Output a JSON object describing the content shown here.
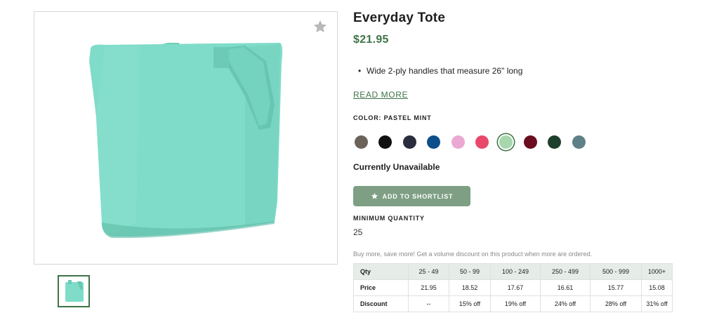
{
  "product": {
    "title": "Everyday Tote",
    "price": "$21.95",
    "bullets": [
      "Wide 2-ply handles that measure 26\" long"
    ],
    "read_more": "READ MORE",
    "color_label": "COLOR: PASTEL MINT",
    "availability": "Currently Unavailable",
    "add_to_shortlist": "ADD TO SHORTLIST",
    "min_qty_label": "MINIMUM QUANTITY",
    "min_qty_value": "25",
    "volume_note": "Buy more, save more! Get a volume discount on this product when more are ordered."
  },
  "swatches": [
    {
      "color": "#6b635a"
    },
    {
      "color": "#111111"
    },
    {
      "color": "#2a2d3d"
    },
    {
      "color": "#0d4f8a"
    },
    {
      "color": "#eba8d2"
    },
    {
      "color": "#e9486b"
    },
    {
      "color": "#a6d7ad",
      "selected": true
    },
    {
      "color": "#6a0d1f"
    },
    {
      "color": "#1d3f2b"
    },
    {
      "color": "#5e8087"
    }
  ],
  "pricing_table": {
    "headers": [
      "Qty",
      "25 - 49",
      "50 - 99",
      "100 - 249",
      "250 - 499",
      "500 - 999",
      "1000+"
    ],
    "rows": [
      [
        "Price",
        "21.95",
        "18.52",
        "17.67",
        "16.61",
        "15.77",
        "15.08"
      ],
      [
        "Discount",
        "--",
        "15% off",
        "19% off",
        "24% off",
        "28% off",
        "31% off"
      ]
    ]
  },
  "colors": {
    "brand_green": "#3d7347",
    "button_green": "#7e9f84",
    "tote_mint": "#7fdcc8",
    "header_row": "#e6ece7"
  },
  "icons": {
    "favorite": "star-icon",
    "shortlist": "star-icon"
  }
}
